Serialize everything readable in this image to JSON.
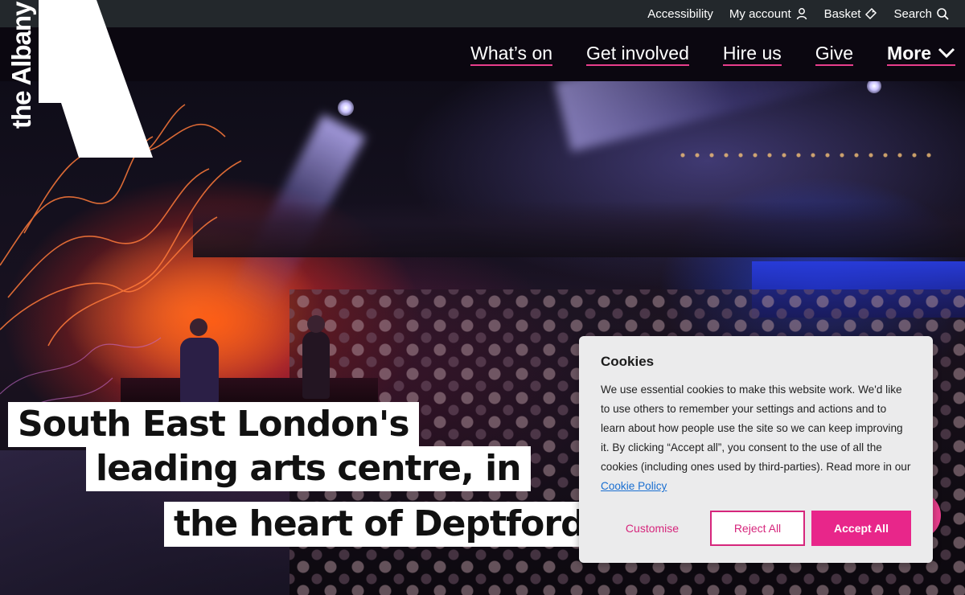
{
  "utility": {
    "accessibility": "Accessibility",
    "my_account": "My account",
    "basket": "Basket",
    "search": "Search"
  },
  "nav": {
    "whats_on": "What’s on",
    "get_involved": "Get involved",
    "hire_us": "Hire us",
    "give": "Give",
    "more": "More"
  },
  "logo": {
    "wordmark": "the Albany"
  },
  "hero": {
    "line1": "South East London's",
    "line2": "leading arts centre, in",
    "line3": "the heart of Deptford."
  },
  "cookies": {
    "title": "Cookies",
    "body": "We use essential cookies to make this website work. We'd like to use others to remember your settings and actions and to learn about how people use the site so we can keep improving it. By clicking “Accept all”, you consent to the use of all the cookies (including ones used by third-parties). Read more in our",
    "policy_link": "Cookie Policy",
    "customise": "Customise",
    "reject": "Reject All",
    "accept": "Accept All"
  },
  "colors": {
    "accent": "#e8268a",
    "utility_bar": "#23282c",
    "nav_bar": "#0b0710",
    "dialog_bg": "#ebebec",
    "link": "#1a6fd1"
  },
  "icons": {
    "my_account": "user-icon",
    "basket": "basket-icon",
    "search": "search-icon",
    "more": "chevron-down-icon"
  }
}
